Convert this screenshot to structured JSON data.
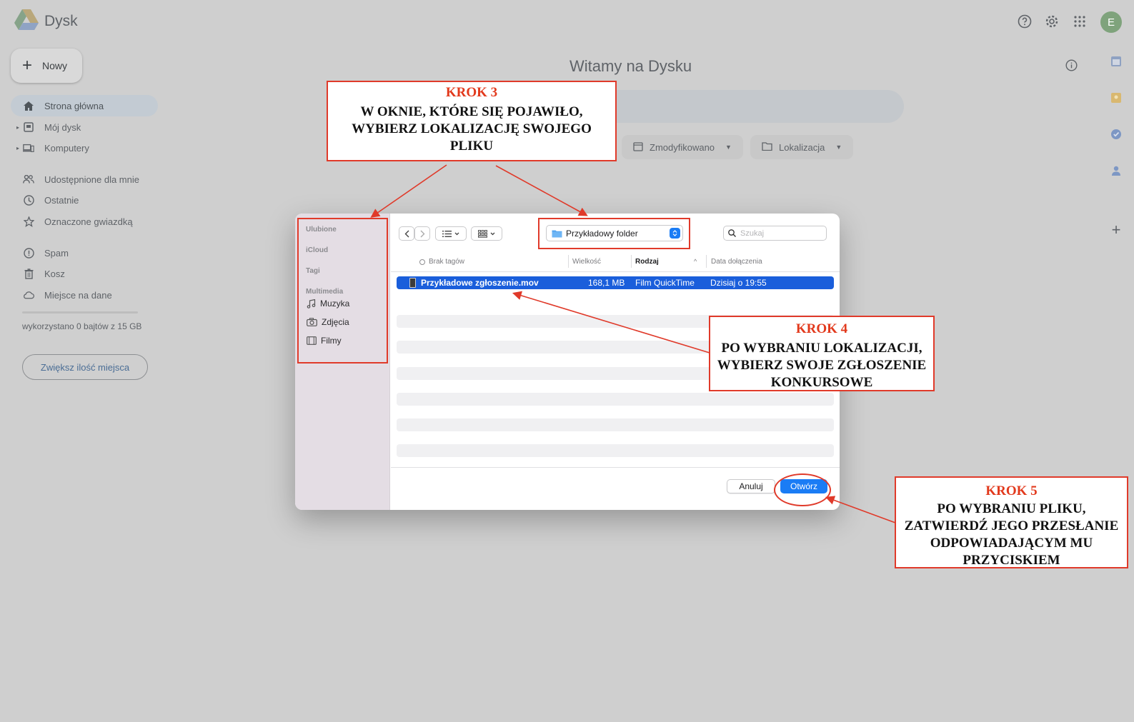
{
  "app": {
    "name": "Dysk"
  },
  "header": {
    "icons": [
      "help-icon",
      "settings-icon",
      "apps-grid-icon"
    ],
    "avatar_letter": "E"
  },
  "sidebar": {
    "new_label": "Nowy",
    "items": [
      {
        "label": "Strona główna",
        "icon": "home-icon"
      },
      {
        "label": "Mój dysk",
        "icon": "my-drive-icon"
      },
      {
        "label": "Komputery",
        "icon": "computer-icon"
      },
      {
        "label": "Udostępnione dla mnie",
        "icon": "shared-icon"
      },
      {
        "label": "Ostatnie",
        "icon": "clock-icon"
      },
      {
        "label": "Oznaczone gwiazdką",
        "icon": "star-icon"
      },
      {
        "label": "Spam",
        "icon": "spam-icon"
      },
      {
        "label": "Kosz",
        "icon": "trash-icon"
      },
      {
        "label": "Miejsce na dane",
        "icon": "cloud-icon"
      }
    ],
    "storage_text": "wykorzystano 0 bajtów z 15 GB",
    "storage_button": "Zwiększ ilość miejsca"
  },
  "main": {
    "welcome": "Witamy na Dysku",
    "filters": [
      "Zmodyfikowano",
      "Lokalizacja"
    ]
  },
  "dialog": {
    "sidebar": {
      "favorites": "Ulubione",
      "icloud": "iCloud",
      "tags": "Tagi",
      "multimedia": "Multimedia",
      "items": [
        "Muzyka",
        "Zdjęcia",
        "Filmy"
      ]
    },
    "folder": "Przykładowy folder",
    "search_placeholder": "Szukaj",
    "columns": [
      "Brak tagów",
      "Wielkość",
      "Rodzaj",
      "Data dołączenia"
    ],
    "file": {
      "name": "Przykładowe zgłoszenie.mov",
      "size": "168,1 MB",
      "kind": "Film QuickTime",
      "date": "Dzisiaj o 19:55"
    },
    "cancel_label": "Anuluj",
    "open_label": "Otwórz"
  },
  "annotations": {
    "step3": {
      "title": "KROK 3",
      "text": "W OKNIE, KTÓRE SIĘ POJAWIŁO, WYBIERZ LOKALIZACJĘ SWOJEGO PLIKU"
    },
    "step4": {
      "title": "KROK 4",
      "text": "PO WYBRANIU LOKALIZACJI, WYBIERZ SWOJE ZGŁOSZENIE KONKURSOWE"
    },
    "step5": {
      "title": "KROK 5",
      "text": "PO WYBRANIU PLIKU, ZATWIERDŹ JEGO PRZESŁANIE ODPOWIADAJĄCYM MU PRZYCISKIEM"
    },
    "color": "#e03a2a"
  },
  "colors": {
    "accent": "#1a7cf5",
    "selection": "#1a5edb",
    "annotation": "#e03a2a"
  }
}
